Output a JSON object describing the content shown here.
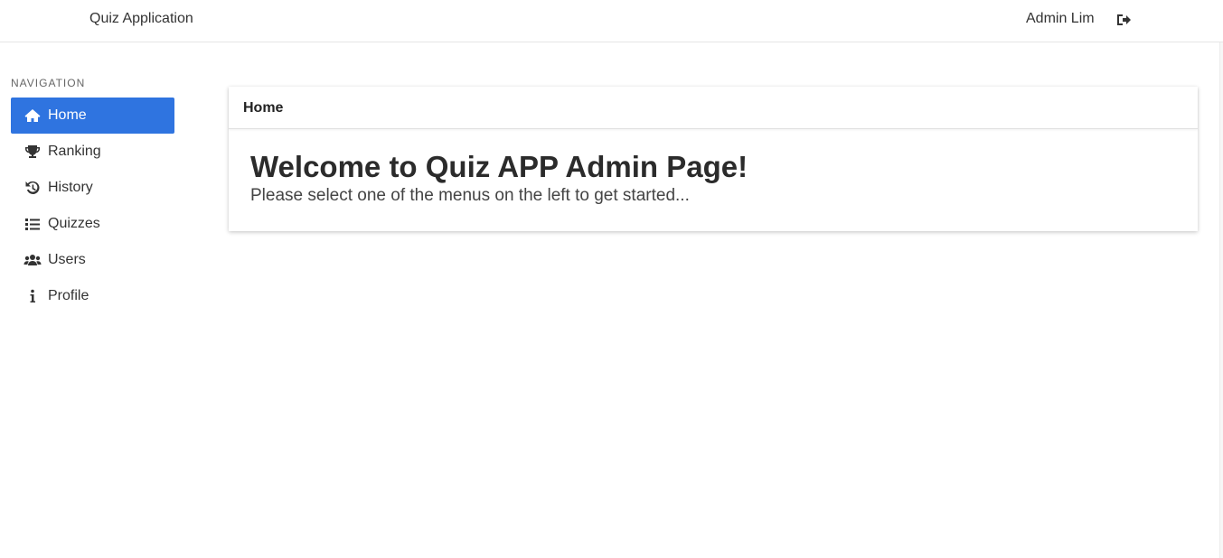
{
  "header": {
    "brand": "Quiz Application",
    "user_name": "Admin Lim",
    "logout_icon": "sign-out-icon"
  },
  "sidebar": {
    "heading": "NAVIGATION",
    "active_color": "#2f74e0",
    "items": [
      {
        "label": "Home",
        "icon": "home-icon",
        "active": true
      },
      {
        "label": "Ranking",
        "icon": "trophy-icon",
        "active": false
      },
      {
        "label": "History",
        "icon": "history-icon",
        "active": false
      },
      {
        "label": "Quizzes",
        "icon": "list-icon",
        "active": false
      },
      {
        "label": "Users",
        "icon": "users-icon",
        "active": false
      },
      {
        "label": "Profile",
        "icon": "info-icon",
        "active": false
      }
    ]
  },
  "main": {
    "card_header": "Home",
    "title": "Welcome to Quiz APP Admin Page!",
    "subtitle": "Please select one of the menus on the left to get started..."
  }
}
